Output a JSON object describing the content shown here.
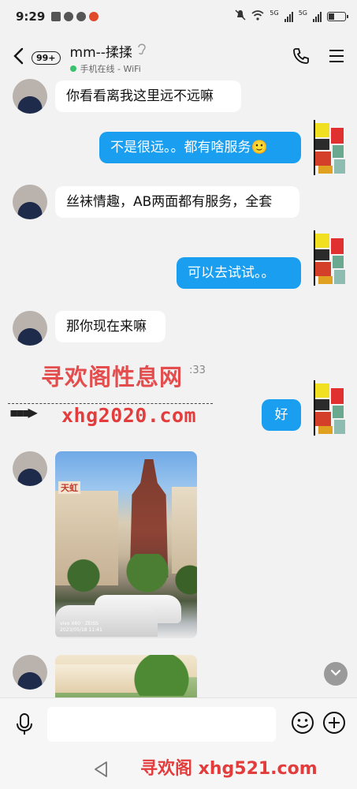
{
  "status_bar": {
    "time": "9:29",
    "net1": "5G",
    "net2": "5G"
  },
  "header": {
    "back_icon": "chevron-left-icon",
    "unread_badge": "99+",
    "contact_name": "mm--揉揉",
    "online_status": "手机在线 - WiFi",
    "online_color": "#37c26b"
  },
  "messages": [
    {
      "side": "in",
      "text": "你看看离我这里远不远嘛"
    },
    {
      "side": "out",
      "text": "不是很远。。都有啥服务🙂"
    },
    {
      "side": "in",
      "text": "丝袜情趣，AB两面都有服务，全套"
    },
    {
      "side": "out",
      "text": "可以去试试。。"
    },
    {
      "side": "in",
      "text": "那你现在来嘛"
    },
    {
      "side": "out",
      "text": "好"
    },
    {
      "side": "in",
      "type": "image",
      "text": "photo-building"
    },
    {
      "side": "in",
      "type": "image",
      "text": "photo-garden"
    }
  ],
  "photo1": {
    "sign": "天虹",
    "caption_1": "vivo X60 · ZEISS",
    "caption_2": "2023/05/18 11:41"
  },
  "timestamp_partial": ":33",
  "watermark": {
    "line1": "寻欢阁性息网",
    "line2": "xhg2020.com",
    "arrow": "▪▪▪▶",
    "footer": "寻欢阁 xhg521.com"
  },
  "input": {
    "placeholder": ""
  },
  "colors": {
    "bubble_out": "#1a9ff0",
    "bubble_in": "#ffffff",
    "watermark": "#e23c3c"
  }
}
